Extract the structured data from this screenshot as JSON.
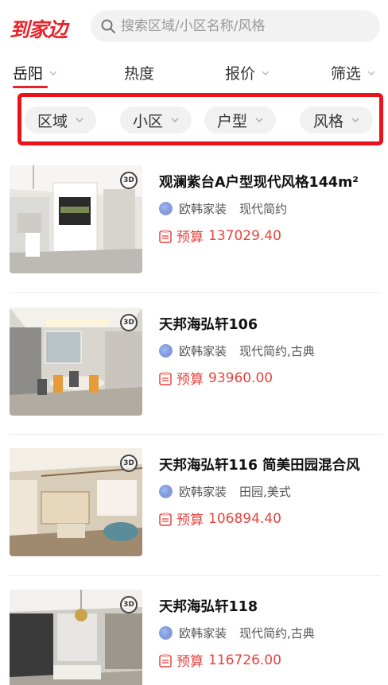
{
  "header": {
    "logo": "到家边",
    "search_placeholder": "搜索区域/小区名称/风格"
  },
  "nav": {
    "tabs": [
      {
        "label": "岳阳"
      },
      {
        "label": "热度"
      },
      {
        "label": "报价"
      },
      {
        "label": "筛选"
      }
    ],
    "active_color": "#e8222b"
  },
  "filters": [
    {
      "label": "区域"
    },
    {
      "label": "小区"
    },
    {
      "label": "户型"
    },
    {
      "label": "风格"
    }
  ],
  "highlight_color": "#e8141b",
  "listings": [
    {
      "title": "观澜紫台A户型现代风格144m²",
      "company": "欧韩家装",
      "style": "现代简约",
      "budget_label": "预算",
      "budget": "137029.40"
    },
    {
      "title": "天邦海弘轩106",
      "company": "欧韩家装",
      "style": "现代简约,古典",
      "budget_label": "预算",
      "budget": "93960.00"
    },
    {
      "title": "天邦海弘轩116 简美田园混合风",
      "company": "欧韩家装",
      "style": "田园,美式",
      "budget_label": "预算",
      "budget": "106894.40"
    },
    {
      "title": "天邦海弘轩118",
      "company": "欧韩家装",
      "style": "现代简约,古典",
      "budget_label": "预算",
      "budget": "116726.00"
    }
  ],
  "badge_3d": "3D"
}
